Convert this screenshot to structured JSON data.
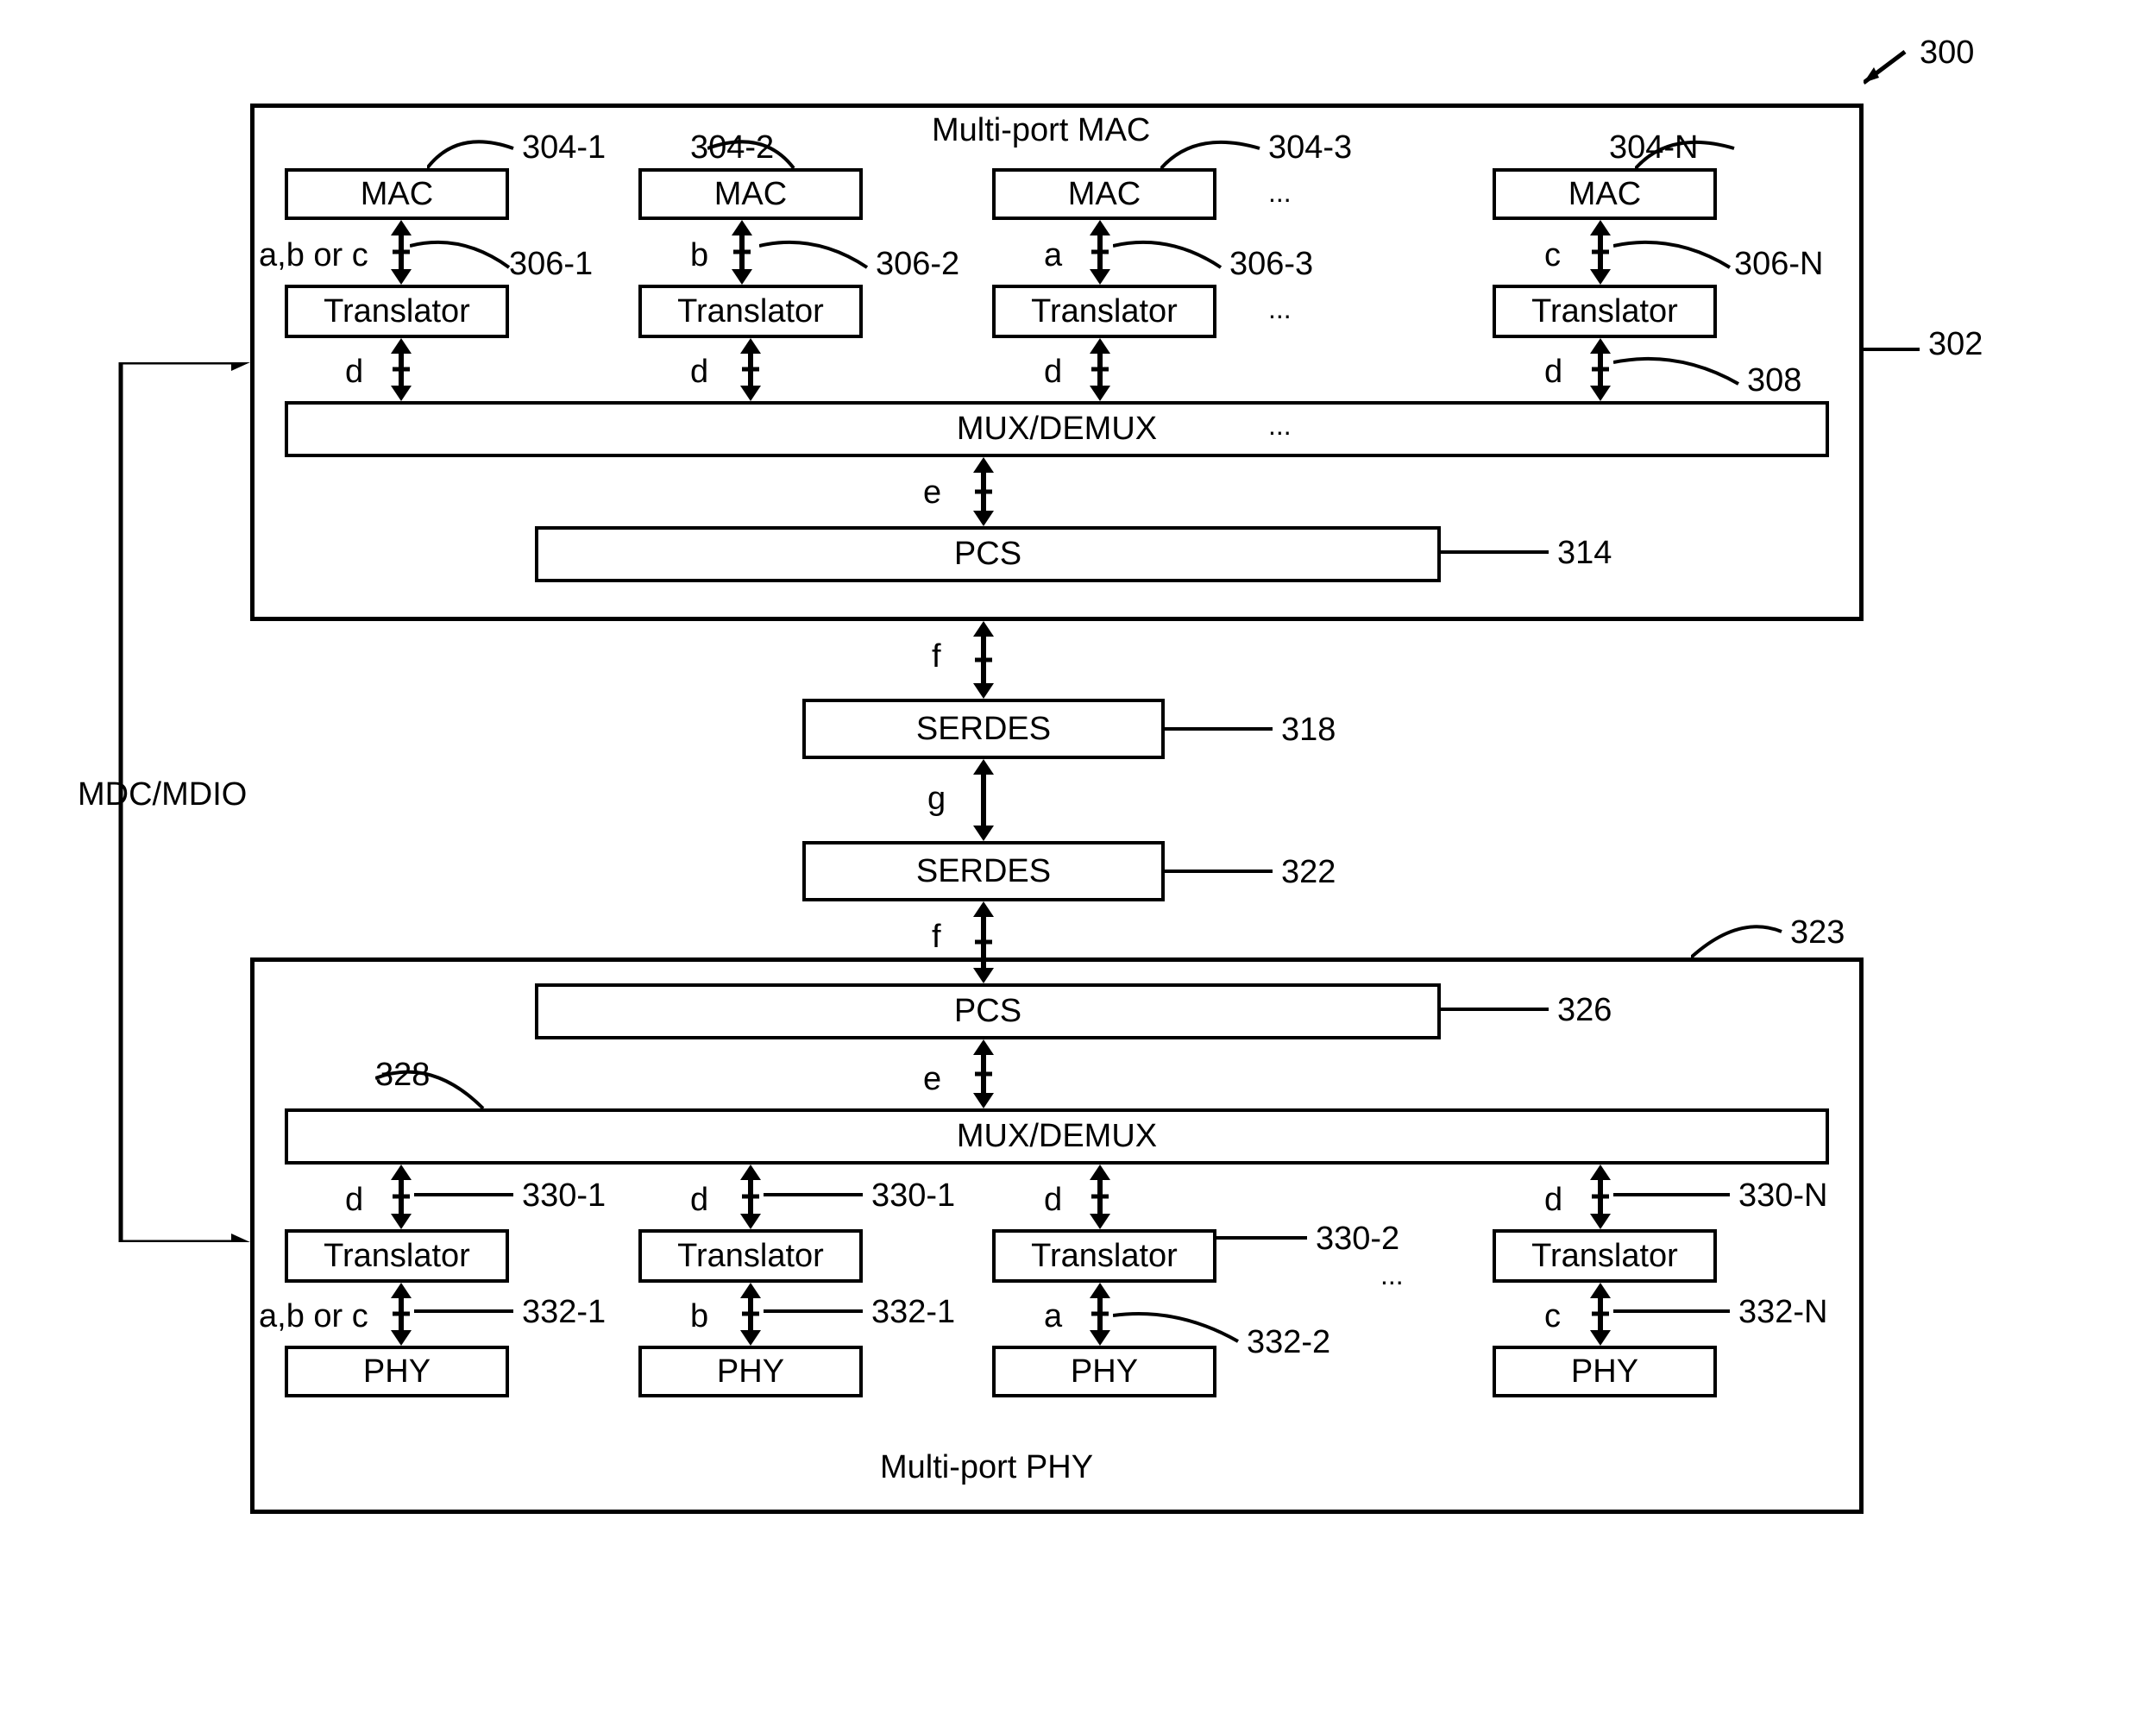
{
  "fig_ref": "300",
  "mdcmdio": "MDC/MDIO",
  "upper": {
    "title": "Multi-port MAC",
    "ref": "302",
    "mac_refs": [
      "304-1",
      "304-2",
      "304-3",
      "304-N"
    ],
    "trans_refs": [
      "306-1",
      "306-2",
      "306-3",
      "306-N"
    ],
    "mux_ref": "308",
    "pcs_ref": "314",
    "mac_label": "MAC",
    "trans_label": "Translator",
    "mux_label": "MUX/DEMUX",
    "pcs_label": "PCS",
    "sig_top": [
      "a,b or c",
      "b",
      "a",
      "c"
    ],
    "sig_mid": "d",
    "sig_muxpcs": "e",
    "dots": "..."
  },
  "mid": {
    "serdes_label": "SERDES",
    "serdes1_ref": "318",
    "serdes2_ref": "322",
    "sig_f": "f",
    "sig_g": "g"
  },
  "lower": {
    "title": "Multi-port PHY",
    "ref": "323",
    "pcs_ref": "326",
    "mux_ref": "328",
    "trans_refs": [
      "330-1",
      "330-1",
      "330-2",
      "330-N"
    ],
    "phy_refs": [
      "332-1",
      "332-1",
      "332-2",
      "332-N"
    ],
    "phy_label": "PHY",
    "trans_label": "Translator",
    "mux_label": "MUX/DEMUX",
    "pcs_label": "PCS",
    "sig_top": [
      "d",
      "d",
      "d",
      "d"
    ],
    "sig_bot": [
      "a,b or c",
      "b",
      "a",
      "c"
    ],
    "sig_muxpcs": "e",
    "sig_pcsf": "f",
    "dots": "..."
  }
}
